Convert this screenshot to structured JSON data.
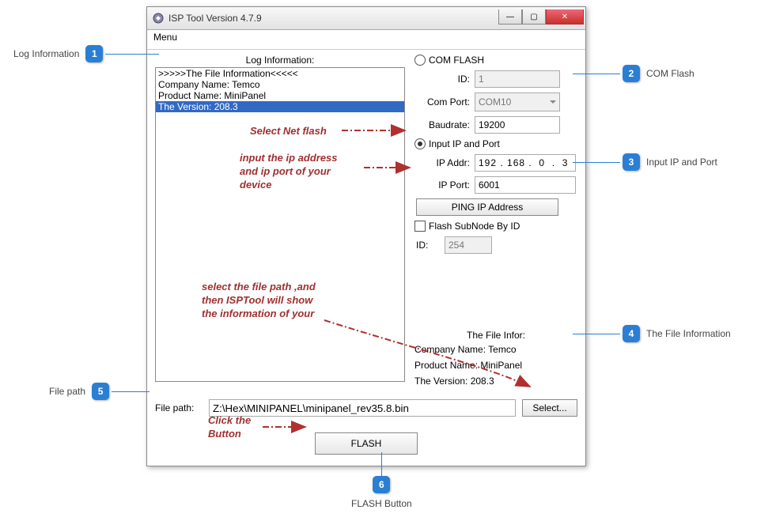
{
  "window": {
    "title": "ISP Tool Version 4.7.9",
    "menu": "Menu"
  },
  "log": {
    "title": "Log Information:",
    "lines": [
      ">>>>>The File Information<<<<<",
      "Company Name: Temco",
      "Product Name: MiniPanel",
      "The Version: 208.3"
    ]
  },
  "comflash": {
    "radio_label": "COM FLASH",
    "id_label": "ID:",
    "id_value": "1",
    "comport_label": "Com Port:",
    "comport_value": "COM10",
    "baud_label": "Baudrate:",
    "baud_value": "19200"
  },
  "ipport": {
    "radio_label": "Input IP and Port",
    "ipaddr_label": "IP Addr:",
    "ipaddr_value": "192 . 168 .  0  .  3",
    "ipport_label": "IP Port:",
    "ipport_value": "6001",
    "ping_label": "PING    IP    Address"
  },
  "subnode": {
    "check_label": "Flash SubNode By ID",
    "id_label": "ID:",
    "id_value": "254"
  },
  "fileinfo": {
    "title": "The File Infor:",
    "company": "Company Name: Temco",
    "product": "Product Name: MiniPanel",
    "version": "The Version: 208.3"
  },
  "filepath": {
    "label": "File path:",
    "value": "Z:\\Hex\\MINIPANEL\\minipanel_rev35.8.bin",
    "select_btn": "Select..."
  },
  "flash_btn": "FLASH",
  "callouts": {
    "c1": {
      "num": "1",
      "label": "Log Information"
    },
    "c2": {
      "num": "2",
      "label": "COM Flash"
    },
    "c3": {
      "num": "3",
      "label": "Input IP and Port"
    },
    "c4": {
      "num": "4",
      "label": "The File Information"
    },
    "c5": {
      "num": "5",
      "label": "File path"
    },
    "c6": {
      "num": "6",
      "label": "FLASH Button"
    }
  },
  "annotations": {
    "a1": "Select Net flash",
    "a2": "input the ip address and ip port of your device",
    "a3": "select the file path ,and then ISPTool will show the information of your",
    "a4": "Click the Button"
  }
}
